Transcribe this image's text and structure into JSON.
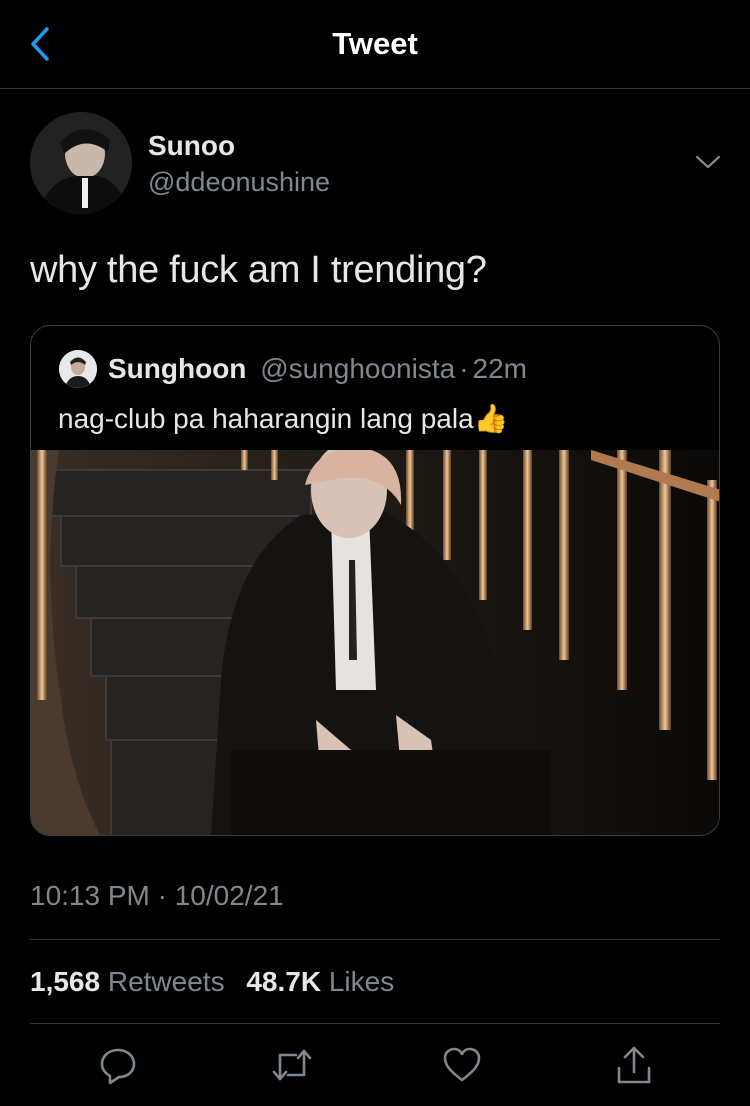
{
  "header": {
    "title": "Tweet"
  },
  "tweet": {
    "author_name": "Sunoo",
    "author_handle": "@ddeonushine",
    "text": "why the fuck am I trending?",
    "timestamp": "10:13 PM · 10/02/21",
    "retweets_count": "1,568",
    "retweets_label": "Retweets",
    "likes_count": "48.7K",
    "likes_label": "Likes"
  },
  "quoted_tweet": {
    "author_name": "Sunghoon",
    "author_handle": "@sunghoonista",
    "separator": "·",
    "time": "22m",
    "text": "nag-club pa haharangin lang pala",
    "emoji": "👍"
  },
  "actions": [
    "reply-icon",
    "retweet-icon",
    "like-icon",
    "share-icon"
  ],
  "colors": {
    "background": "#000000",
    "accent": "#1d9bf0",
    "muted": "#7d8891"
  }
}
